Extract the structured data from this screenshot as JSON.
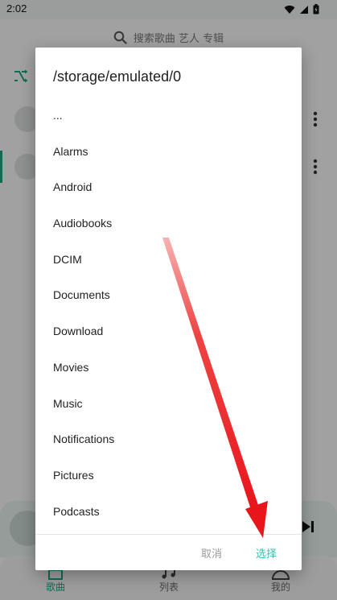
{
  "status_bar": {
    "time": "2:02"
  },
  "search": {
    "placeholder": "搜索歌曲 艺人 专辑"
  },
  "bottom_nav": {
    "items": [
      {
        "label": "歌曲"
      },
      {
        "label": "列表"
      },
      {
        "label": "我的"
      }
    ]
  },
  "dialog": {
    "title": "/storage/emulated/0",
    "items": [
      "...",
      "Alarms",
      "Android",
      "Audiobooks",
      "DCIM",
      "Documents",
      "Download",
      "Movies",
      "Music",
      "Notifications",
      "Pictures",
      "Podcasts"
    ],
    "cancel_label": "取消",
    "select_label": "选择"
  },
  "colors": {
    "accent": "#1aa37f",
    "select_text": "#31c4b5",
    "arrow": "#e8151b"
  },
  "icons": [
    "wifi-icon",
    "signal-icon",
    "battery-icon",
    "search-icon",
    "shuffle-icon",
    "more-vert-icon",
    "skip-next-icon",
    "home-icon",
    "music-note-icon",
    "user-icon"
  ]
}
